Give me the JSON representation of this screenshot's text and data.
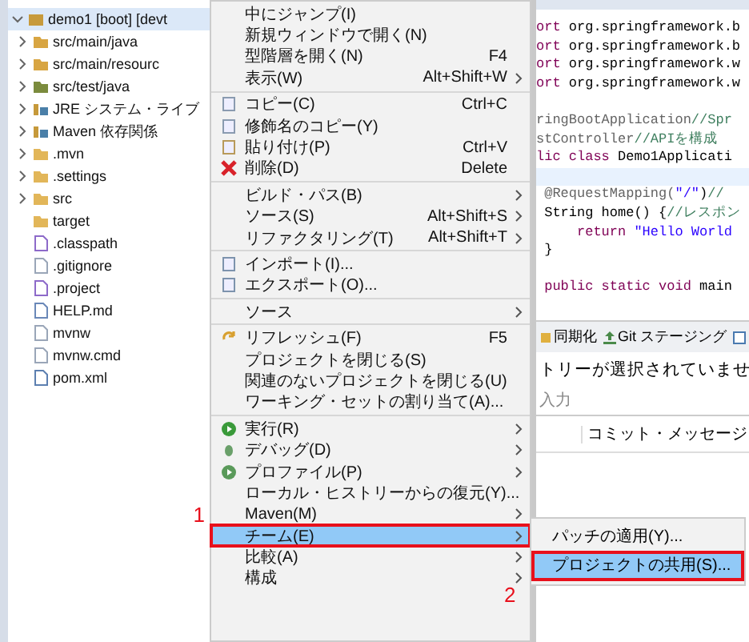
{
  "explorer": {
    "tree": [
      {
        "label": "demo1 [boot] [devt",
        "kind": "project",
        "expanded": true,
        "selected": true,
        "children": [
          {
            "label": "src/main/java",
            "kind": "source-folder",
            "expanded": false,
            "selected": false
          },
          {
            "label": "src/main/resourc",
            "kind": "source-folder",
            "expanded": false,
            "selected": false
          },
          {
            "label": "src/test/java",
            "kind": "test-folder",
            "expanded": false,
            "selected": false
          },
          {
            "label": "JRE システム・ライブ",
            "kind": "library",
            "expanded": false,
            "selected": false
          },
          {
            "label": "Maven 依存関係",
            "kind": "library",
            "expanded": false,
            "selected": false
          },
          {
            "label": ".mvn",
            "kind": "folder",
            "expanded": false,
            "selected": false
          },
          {
            "label": ".settings",
            "kind": "folder",
            "expanded": false,
            "selected": false
          },
          {
            "label": "src",
            "kind": "folder",
            "expanded": false,
            "selected": false
          },
          {
            "label": "target",
            "kind": "folder",
            "selected": false
          },
          {
            "label": ".classpath",
            "kind": "xml-file",
            "selected": false
          },
          {
            "label": ".gitignore",
            "kind": "file",
            "selected": false
          },
          {
            "label": ".project",
            "kind": "xml-file",
            "selected": false
          },
          {
            "label": "HELP.md",
            "kind": "doc-file",
            "selected": false
          },
          {
            "label": "mvnw",
            "kind": "file",
            "selected": false
          },
          {
            "label": "mvnw.cmd",
            "kind": "file",
            "selected": false
          },
          {
            "label": "pom.xml",
            "kind": "maven-file",
            "selected": false
          }
        ]
      }
    ]
  },
  "context_menu": {
    "groups": [
      [
        {
          "label": "中にジャンプ(I)",
          "selected": false
        },
        {
          "label": "新規ウィンドウで開く(N)",
          "selected": false
        },
        {
          "label": "型階層を開く(N)",
          "shortcut": "F4",
          "selected": false
        },
        {
          "label": "表示(W)",
          "shortcut": "Alt+Shift+W",
          "submenu": true,
          "selected": false
        }
      ],
      [
        {
          "label": "コピー(C)",
          "kind": "copy",
          "shortcut": "Ctrl+C",
          "selected": false
        },
        {
          "label": "修飾名のコピー(Y)",
          "kind": "copy",
          "selected": false
        },
        {
          "label": "貼り付け(P)",
          "kind": "paste",
          "shortcut": "Ctrl+V",
          "selected": false
        },
        {
          "label": "削除(D)",
          "kind": "delete",
          "shortcut": "Delete",
          "selected": false
        }
      ],
      [
        {
          "label": "ビルド・パス(B)",
          "submenu": true,
          "selected": false
        },
        {
          "label": "ソース(S)",
          "shortcut": "Alt+Shift+S",
          "submenu": true,
          "selected": false
        },
        {
          "label": "リファクタリング(T)",
          "shortcut": "Alt+Shift+T",
          "submenu": true,
          "selected": false
        }
      ],
      [
        {
          "label": "インポート(I)...",
          "kind": "import",
          "selected": false
        },
        {
          "label": "エクスポート(O)...",
          "kind": "export",
          "selected": false
        }
      ],
      [
        {
          "label": "ソース",
          "submenu": true,
          "selected": false
        }
      ],
      [
        {
          "label": "リフレッシュ(F)",
          "kind": "refresh",
          "shortcut": "F5",
          "selected": false
        },
        {
          "label": "プロジェクトを閉じる(S)",
          "selected": false
        },
        {
          "label": "関連のないプロジェクトを閉じる(U)",
          "selected": false
        },
        {
          "label": "ワーキング・セットの割り当て(A)...",
          "selected": false
        }
      ],
      [
        {
          "label": "実行(R)",
          "kind": "run",
          "submenu": true,
          "selected": false
        },
        {
          "label": "デバッグ(D)",
          "kind": "debug",
          "submenu": true,
          "selected": false
        },
        {
          "label": "プロファイル(P)",
          "kind": "profile",
          "submenu": true,
          "selected": false
        },
        {
          "label": "ローカル・ヒストリーからの復元(Y)...",
          "selected": false
        },
        {
          "label": "Maven(M)",
          "submenu": true,
          "selected": false
        },
        {
          "label": "チーム(E)",
          "submenu": true,
          "selected": true,
          "annotation": "1",
          "children": [
            {
              "label": "パッチの適用(Y)...",
              "selected": false
            },
            {
              "label": "プロジェクトの共用(S)...",
              "selected": true,
              "annotation": "2"
            }
          ]
        },
        {
          "label": "比較(A)",
          "submenu": true,
          "selected": false
        },
        {
          "label": "構成",
          "submenu": true,
          "selected": false
        }
      ]
    ]
  },
  "editor": {
    "lines": [
      {
        "parts": [
          {
            "kind": "keyword",
            "text": "ort"
          },
          {
            "kind": "plain",
            "text": " org.springframework.b"
          }
        ]
      },
      {
        "parts": [
          {
            "kind": "keyword",
            "text": "ort"
          },
          {
            "kind": "plain",
            "text": " org.springframework.b"
          }
        ]
      },
      {
        "parts": [
          {
            "kind": "keyword",
            "text": "ort"
          },
          {
            "kind": "plain",
            "text": " org.springframework.w"
          }
        ]
      },
      {
        "parts": [
          {
            "kind": "keyword",
            "text": "ort"
          },
          {
            "kind": "plain",
            "text": " org.springframework.w"
          }
        ]
      },
      {
        "gap_before": true,
        "parts": [
          {
            "kind": "annotation",
            "text": "ringBootApplication"
          },
          {
            "kind": "comment",
            "text": "//Spr"
          }
        ]
      },
      {
        "parts": [
          {
            "kind": "annotation",
            "text": "stController"
          },
          {
            "kind": "comment",
            "text": "//APIを構成"
          }
        ]
      },
      {
        "parts": [
          {
            "kind": "keyword",
            "text": "lic class"
          },
          {
            "kind": "plain",
            "text": " Demo1Applicati"
          }
        ]
      },
      {
        "current": true
      },
      {
        "parts": [
          {
            "kind": "annotation",
            "text": " @RequestMapping("
          },
          {
            "kind": "string",
            "text": "\"/\""
          },
          {
            "kind": "plain",
            "text": ")"
          },
          {
            "kind": "comment",
            "text": "//"
          }
        ]
      },
      {
        "parts": [
          {
            "kind": "plain",
            "text": " String home() {"
          },
          {
            "kind": "comment",
            "text": "//レスポン"
          }
        ]
      },
      {
        "parts": [
          {
            "kind": "keyword",
            "text": "     return"
          },
          {
            "kind": "string",
            "text": " \"Hello World"
          }
        ]
      },
      {
        "parts": [
          {
            "kind": "plain",
            "text": " }"
          }
        ]
      },
      {
        "gap_before": true,
        "parts": [
          {
            "kind": "keyword",
            "text": " public static void"
          },
          {
            "kind": "plain",
            "text": " main"
          }
        ]
      }
    ]
  },
  "bottom_panel": {
    "tabs": [
      {
        "label": "同期化",
        "kind": "sync"
      },
      {
        "label": "Git ステージング",
        "kind": "staging"
      },
      {
        "kind": "git"
      }
    ],
    "message": "トリーが選択されていませ",
    "filter": {
      "placeholder": "入力"
    },
    "columns": [
      "コミット・メッセージ"
    ]
  }
}
